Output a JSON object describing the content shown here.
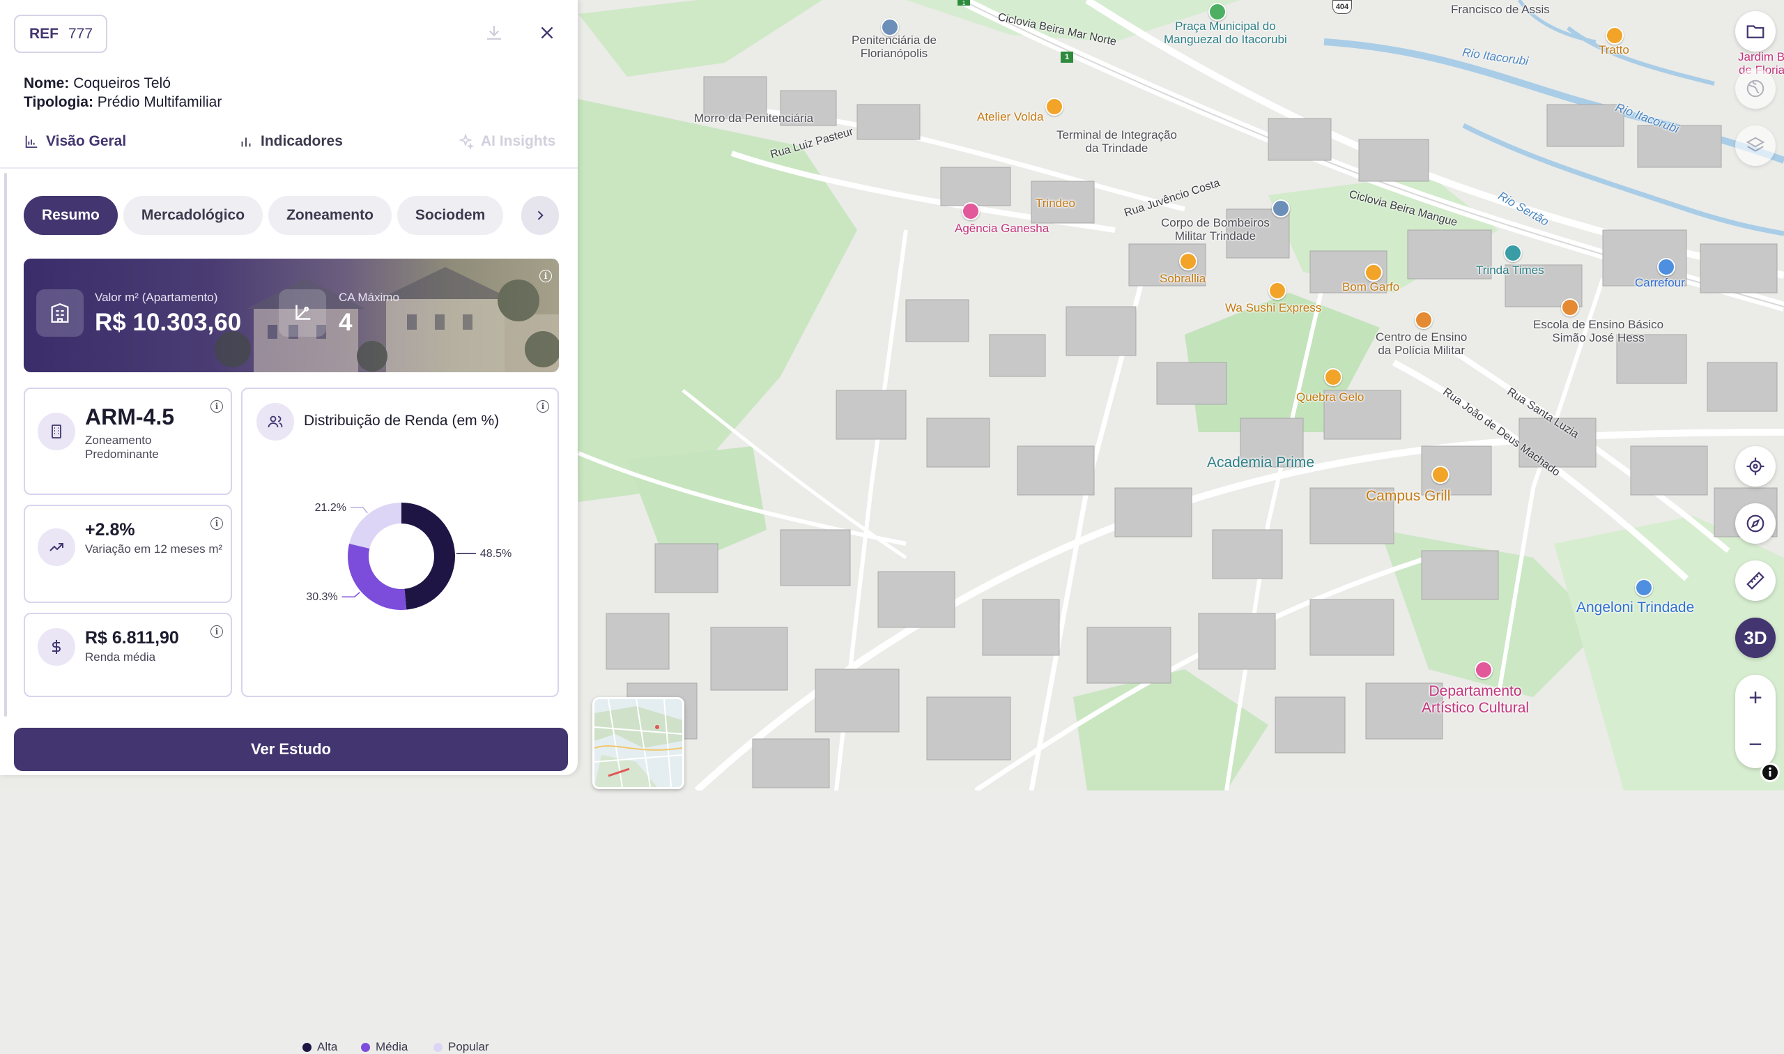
{
  "panel": {
    "ref_label": "REF",
    "ref_value": "777",
    "nome_label": "Nome:",
    "nome_value": "Coqueiros Teló",
    "tipologia_label": "Tipologia:",
    "tipologia_value": "Prédio Multifamiliar",
    "tabs": [
      {
        "label": "Visão Geral",
        "icon": "bar-chart-icon",
        "state": "active"
      },
      {
        "label": "Indicadores",
        "icon": "bar-chart-icon",
        "state": "default"
      },
      {
        "label": "AI Insights",
        "icon": "sparkle-icon",
        "state": "disabled"
      }
    ],
    "chips": [
      "Resumo",
      "Mercadológico",
      "Zoneamento",
      "Sociodem"
    ],
    "active_chip": "Resumo",
    "hero": {
      "valor_label": "Valor m² (Apartamento)",
      "valor": "R$ 10.303,60",
      "ca_label": "CA Máximo",
      "ca": "4"
    },
    "cards": {
      "zoneamento": {
        "value": "ARM-4.5",
        "label": "Zoneamento Predominante"
      },
      "variacao": {
        "value": "+2.8%",
        "label": "Variação em 12 meses m²"
      },
      "renda": {
        "value": "R$ 6.811,90",
        "label": "Renda média"
      }
    },
    "cta_label": "Ver Estudo"
  },
  "chart_data": {
    "type": "pie",
    "title": "Distribuição de Renda (em %)",
    "categories": [
      "Alta",
      "Média",
      "Popular"
    ],
    "values": [
      48.5,
      30.3,
      21.2
    ],
    "value_labels": [
      "48.5%",
      "30.3%",
      "21.2%"
    ],
    "colors": [
      "#1f1545",
      "#7c4ddb",
      "#ddd5f6"
    ],
    "donut": true,
    "legend_position": "bottom"
  },
  "map": {
    "labels": [
      {
        "text": "Penitenciária de\nFlorianópolis",
        "style": "gray"
      },
      {
        "text": "Morro da Penitenciária",
        "style": "gray"
      },
      {
        "text": "Atelier Volda",
        "style": "orange"
      },
      {
        "text": "Terminal de Integração\nda Trindade",
        "style": "gray"
      },
      {
        "text": "Trindeo",
        "style": "orange"
      },
      {
        "text": "Agência Ganesha",
        "style": "pink"
      },
      {
        "text": "Praça Municipal do\nManguezal do Itacorubi",
        "style": "teal"
      },
      {
        "text": "Corpo de Bombeiros\nMilitar Trindade",
        "style": "gray"
      },
      {
        "text": "Sobrallia",
        "style": "orange"
      },
      {
        "text": "Wa Sushi Express",
        "style": "orange"
      },
      {
        "text": "Bom Garfo",
        "style": "orange"
      },
      {
        "text": "Trinda Times",
        "style": "teal"
      },
      {
        "text": "Carrefour",
        "style": "blue"
      },
      {
        "text": "Centro de Ensino\nda Polícia Militar",
        "style": "gray"
      },
      {
        "text": "Escola de Ensino Básico\nSimão José Hess",
        "style": "gray"
      },
      {
        "text": "Quebra Gelo",
        "style": "orange"
      },
      {
        "text": "Academia Prime",
        "style": "teal"
      },
      {
        "text": "Campus Grill",
        "style": "orange"
      },
      {
        "text": "Angeloni Trindade",
        "style": "blue"
      },
      {
        "text": "Departamento\nArtístico Cultural",
        "style": "pink"
      },
      {
        "text": "Tratto",
        "style": "orange"
      },
      {
        "text": "Jardim Botânico\nde Florianópolis",
        "style": "pink"
      },
      {
        "text": "Francisco de Assis",
        "style": "gray"
      }
    ],
    "streets": [
      "Ciclovia Beira Mar Norte",
      "Rua Luiz Pasteur",
      "Rua Juvêncio Costa",
      "Ciclovia Beira Mangue",
      "Rua João de Deus Machado",
      "Rua Santa Luzia"
    ],
    "rivers": [
      "Rio Itacorubi",
      "Rio Itacorubi",
      "Rio Sertão"
    ],
    "route_shields": [
      "404",
      "1",
      "1"
    ],
    "controls": {
      "view_mode": "3D",
      "icons": [
        "folder-icon",
        "globe-icon",
        "layers-icon",
        "locate-icon",
        "compass-icon",
        "ruler-icon"
      ]
    }
  }
}
